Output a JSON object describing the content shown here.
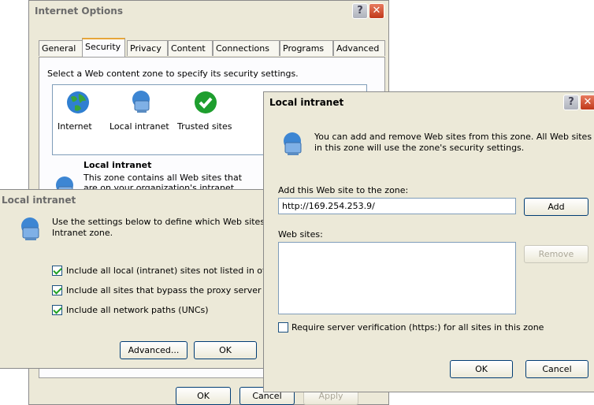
{
  "internet_options": {
    "title": "Internet Options",
    "tabs": [
      "General",
      "Security",
      "Privacy",
      "Content",
      "Connections",
      "Programs",
      "Advanced"
    ],
    "zone_prompt": "Select a Web content zone to specify its security settings.",
    "zones": [
      {
        "label": "Internet",
        "icon": "globe-icon"
      },
      {
        "label": "Local intranet",
        "icon": "computer-globe-icon"
      },
      {
        "label": "Trusted sites",
        "icon": "checkmark-icon"
      }
    ],
    "selected_zone_title": "Local intranet",
    "zone_description": "This zone contains all Web sites that are on your organization's intranet.",
    "buttons": {
      "ok": "OK",
      "cancel": "Cancel",
      "apply": "Apply"
    }
  },
  "local_intranet": {
    "title": "Local intranet",
    "description": "Use the settings below to define which Web sites to include in the Local Intranet zone.",
    "options": [
      {
        "label": "Include all local (intranet) sites not listed in other zones",
        "checked": true
      },
      {
        "label": "Include all sites that bypass the proxy server",
        "checked": true
      },
      {
        "label": "Include all network paths (UNCs)",
        "checked": true
      }
    ],
    "buttons": {
      "advanced": "Advanced...",
      "ok": "OK"
    }
  },
  "sites_dialog": {
    "title": "Local intranet",
    "info": "You can add and remove Web sites from this zone. All Web sites in this zone will use the zone's security settings.",
    "add_label": "Add this Web site to the zone:",
    "url_value": "http://169.254.253.9/",
    "add_button": "Add",
    "websites_label": "Web sites:",
    "websites": [],
    "remove_button": "Remove",
    "require_https_label": "Require server verification (https:) for all sites in this zone",
    "require_https_checked": false,
    "buttons": {
      "ok": "OK",
      "cancel": "Cancel"
    }
  },
  "colors": {
    "dialog_bg": "#ece9d8",
    "title_text": "#000000",
    "close_button": "#c1391b",
    "tab_highlight": "#e6a63a"
  }
}
